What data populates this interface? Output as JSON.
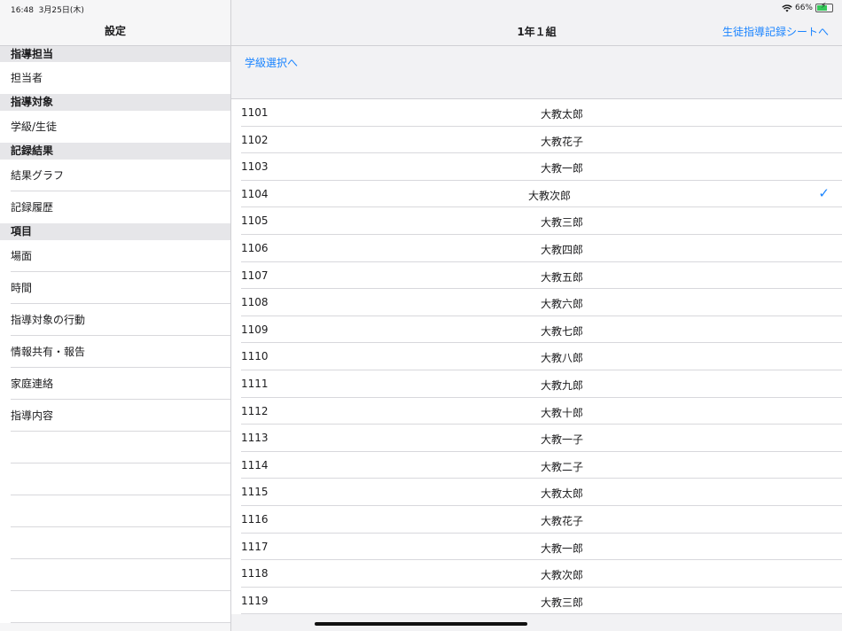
{
  "status": {
    "time": "16:48",
    "date": "3月25日(木)",
    "battery": "66%",
    "battery_level": 0.66
  },
  "sidebar": {
    "title": "設定",
    "sections": [
      {
        "header": "指導担当",
        "items": [
          "担当者"
        ]
      },
      {
        "header": "指導対象",
        "items": [
          "学級/生徒"
        ]
      },
      {
        "header": "記録結果",
        "items": [
          "結果グラフ",
          "記録履歴"
        ]
      },
      {
        "header": "項目",
        "items": [
          "場面",
          "時間",
          "指導対象の行動",
          "情報共有・報告",
          "家庭連絡",
          "指導内容"
        ]
      }
    ]
  },
  "main": {
    "title": "1年１組",
    "right_link": "生徒指導記録シートへ",
    "class_select_link": "学級選択へ",
    "selected_index": 3,
    "accent_color": "#1a84ff",
    "rows": [
      {
        "num": "1101",
        "name": "大教太郎"
      },
      {
        "num": "1102",
        "name": "大教花子"
      },
      {
        "num": "1103",
        "name": "大教一郎"
      },
      {
        "num": "1104",
        "name": "大教次郎"
      },
      {
        "num": "1105",
        "name": "大教三郎"
      },
      {
        "num": "1106",
        "name": "大教四郎"
      },
      {
        "num": "1107",
        "name": "大教五郎"
      },
      {
        "num": "1108",
        "name": "大教六郎"
      },
      {
        "num": "1109",
        "name": "大教七郎"
      },
      {
        "num": "1110",
        "name": "大教八郎"
      },
      {
        "num": "1111",
        "name": "大教九郎"
      },
      {
        "num": "1112",
        "name": "大教十郎"
      },
      {
        "num": "1113",
        "name": "大教一子"
      },
      {
        "num": "1114",
        "name": "大教二子"
      },
      {
        "num": "1115",
        "name": "大教太郎"
      },
      {
        "num": "1116",
        "name": "大教花子"
      },
      {
        "num": "1117",
        "name": "大教一郎"
      },
      {
        "num": "1118",
        "name": "大教次郎"
      },
      {
        "num": "1119",
        "name": "大教三郎"
      }
    ]
  }
}
